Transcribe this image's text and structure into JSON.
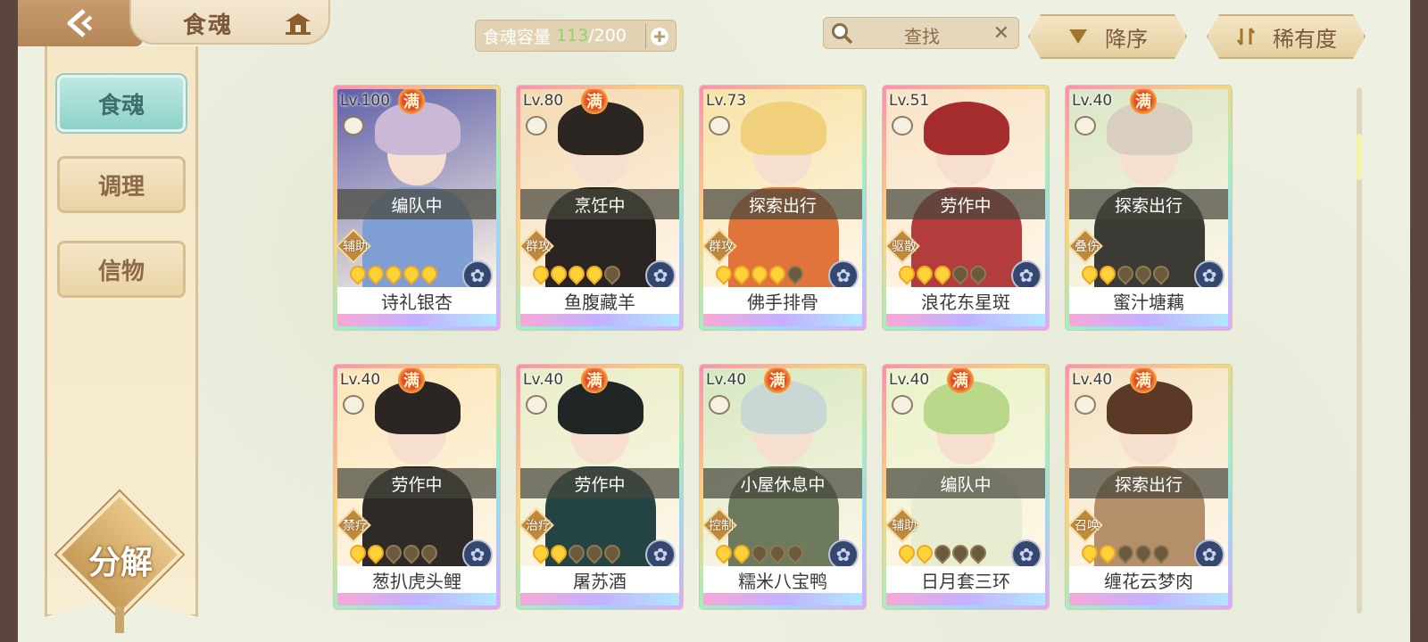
{
  "header": {
    "title": "食魂",
    "capacity_label": "食魂容量",
    "capacity_current": "113",
    "capacity_max": "/200",
    "search_label": "查找",
    "sort_order_label": "降序",
    "sort_key_label": "稀有度"
  },
  "sidebar": {
    "items": [
      {
        "label": "食魂",
        "active": true
      },
      {
        "label": "调理",
        "active": false
      },
      {
        "label": "信物",
        "active": false
      }
    ],
    "decompose_label": "分解"
  },
  "cards": [
    {
      "level": "Lv.100",
      "full": "满",
      "status": "编队中",
      "role": "辅助",
      "stars_on": 5,
      "name": "诗礼银杏",
      "bg": "#5d5fa8",
      "hair": "#cbb7d6",
      "outfit": "#7f9ed4"
    },
    {
      "level": "Lv.80",
      "full": "满",
      "status": "烹饪中",
      "role": "群攻",
      "stars_on": 4,
      "name": "鱼腹藏羊",
      "bg": "#f3d9b0",
      "hair": "#2c2623",
      "outfit": "#2a2522"
    },
    {
      "level": "Lv.73",
      "full": "",
      "status": "探索出行",
      "role": "群攻",
      "stars_on": 4,
      "name": "佛手排骨",
      "bg": "#f6e3a6",
      "hair": "#f0d07a",
      "outfit": "#e0743a"
    },
    {
      "level": "Lv.51",
      "full": "",
      "status": "劳作中",
      "role": "驱散",
      "stars_on": 3,
      "name": "浪花东星斑",
      "bg": "#f8e3c6",
      "hair": "#a62d2d",
      "outfit": "#b33d3d"
    },
    {
      "level": "Lv.40",
      "full": "满",
      "status": "探索出行",
      "role": "叠伤",
      "stars_on": 2,
      "name": "蜜汁塘藕",
      "bg": "#d9e6c6",
      "hair": "#d8cfc0",
      "outfit": "#3c3a34"
    },
    {
      "level": "Lv.40",
      "full": "满",
      "status": "劳作中",
      "role": "禁疗",
      "stars_on": 2,
      "name": "葱扒虎头鲤",
      "bg": "#fae6b8",
      "hair": "#2b2523",
      "outfit": "#2e2a28"
    },
    {
      "level": "Lv.40",
      "full": "满",
      "status": "劳作中",
      "role": "治疗",
      "stars_on": 2,
      "name": "屠苏酒",
      "bg": "#e8eec8",
      "hair": "#1f2625",
      "outfit": "#244444"
    },
    {
      "level": "Lv.40",
      "full": "满",
      "status": "小屋休息中",
      "role": "控制",
      "stars_on": 2,
      "name": "糯米八宝鸭",
      "bg": "#d5e8c0",
      "hair": "#c9d8d4",
      "outfit": "#6d7a5e"
    },
    {
      "level": "Lv.40",
      "full": "满",
      "status": "编队中",
      "role": "辅助",
      "stars_on": 2,
      "name": "日月套三环",
      "bg": "#e9f3c8",
      "hair": "#b9d88a",
      "outfit": "#e8ecd0"
    },
    {
      "level": "Lv.40",
      "full": "满",
      "status": "探索出行",
      "role": "召唤",
      "stars_on": 2,
      "name": "缠花云梦肉",
      "bg": "#f4e3c4",
      "hair": "#5a3a26",
      "outfit": "#b58e6a"
    }
  ]
}
